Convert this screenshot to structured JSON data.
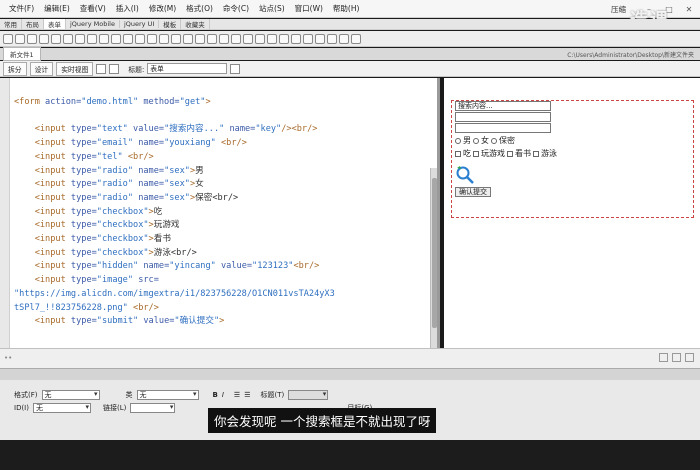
{
  "menu": [
    "文件(F)",
    "编辑(E)",
    "查看(V)",
    "插入(I)",
    "修改(M)",
    "格式(O)",
    "命令(C)",
    "站点(S)",
    "窗口(W)",
    "帮助(H)"
  ],
  "workspace_mode": "压缩",
  "watermark": "造课",
  "insert_tabs": [
    "常用",
    "布局",
    "表单",
    "jQuery Mobile",
    "jQuery UI",
    "模板",
    "收藏夹"
  ],
  "active_insert_tab": "表单",
  "doc": {
    "filename": "新文件1",
    "path": "C:\\Users\\Administrator\\Desktop\\新建文件夹"
  },
  "view_buttons": {
    "code": "拆分",
    "split": "设计",
    "live": "实时视图"
  },
  "title_label": "标题:",
  "title_value": "表单",
  "code_lines": {
    "l1_tag": "<form ",
    "l1_a1": "action=",
    "l1_v1": "\"demo.html\"",
    "l1_a2": " method=",
    "l1_v2": "\"get\"",
    "l1_end": ">",
    "l2_tag": "<input ",
    "l2_a1": "type=",
    "l2_v1": "\"text\"",
    "l2_a2": " value=",
    "l2_v2": "\"搜索内容...\"",
    "l2_a3": " name=",
    "l2_v3": "\"key\"",
    "l2_end": "/><br/>",
    "l3_v1": "\"email\"",
    "l3_v2": "\"youxiang\"",
    "l3_end": "<br/>",
    "l4_v1": "\"tel\"",
    "l4_end": "<br/>",
    "l5_v1": "\"radio\"",
    "l5_v2": "\"sex\"",
    "l5_txt": "男",
    "l6_txt": "女",
    "l7_txt": "保密<br/>",
    "l8_v1": "\"checkbox\"",
    "l8_txt": "吃",
    "l9_txt": "玩游戏",
    "l10_txt": "看书",
    "l11_txt": "游泳<br/>",
    "l12_v1": "\"hidden\"",
    "l12_v2": "\"yincang\"",
    "l12_v3": "\"123123\"",
    "l12_end": "<br/>",
    "l13_v1": "\"image\"",
    "l13_a2": " src=",
    "l14_url": "\"https://img.alicdn.com/imgextra/i1/823756228/O1CN011vsTA24yX3",
    "l15_url": "tSPl7_!!823756228.png\"",
    "l15_end": "<br/>",
    "l16_v1": "\"submit\"",
    "l16_v2": "\"确认提交\"",
    "l16_end": ">"
  },
  "design": {
    "search_value": "搜索内容...",
    "radio_labels": [
      "男",
      "女",
      "保密"
    ],
    "check_labels": [
      "吃",
      "玩游戏",
      "看书",
      "游泳"
    ],
    "submit_label": "确认提交"
  },
  "props": {
    "format_label": "格式(F)",
    "format_value": "无",
    "class_label": "类",
    "class_value": "无",
    "id_label": "ID(I)",
    "id_value": "无",
    "link_label": "链接(L)",
    "title_label": "标题(T)",
    "target_label": "目标(G)"
  },
  "subtitle": "你会发现呢 一个搜索框是不就出现了呀"
}
